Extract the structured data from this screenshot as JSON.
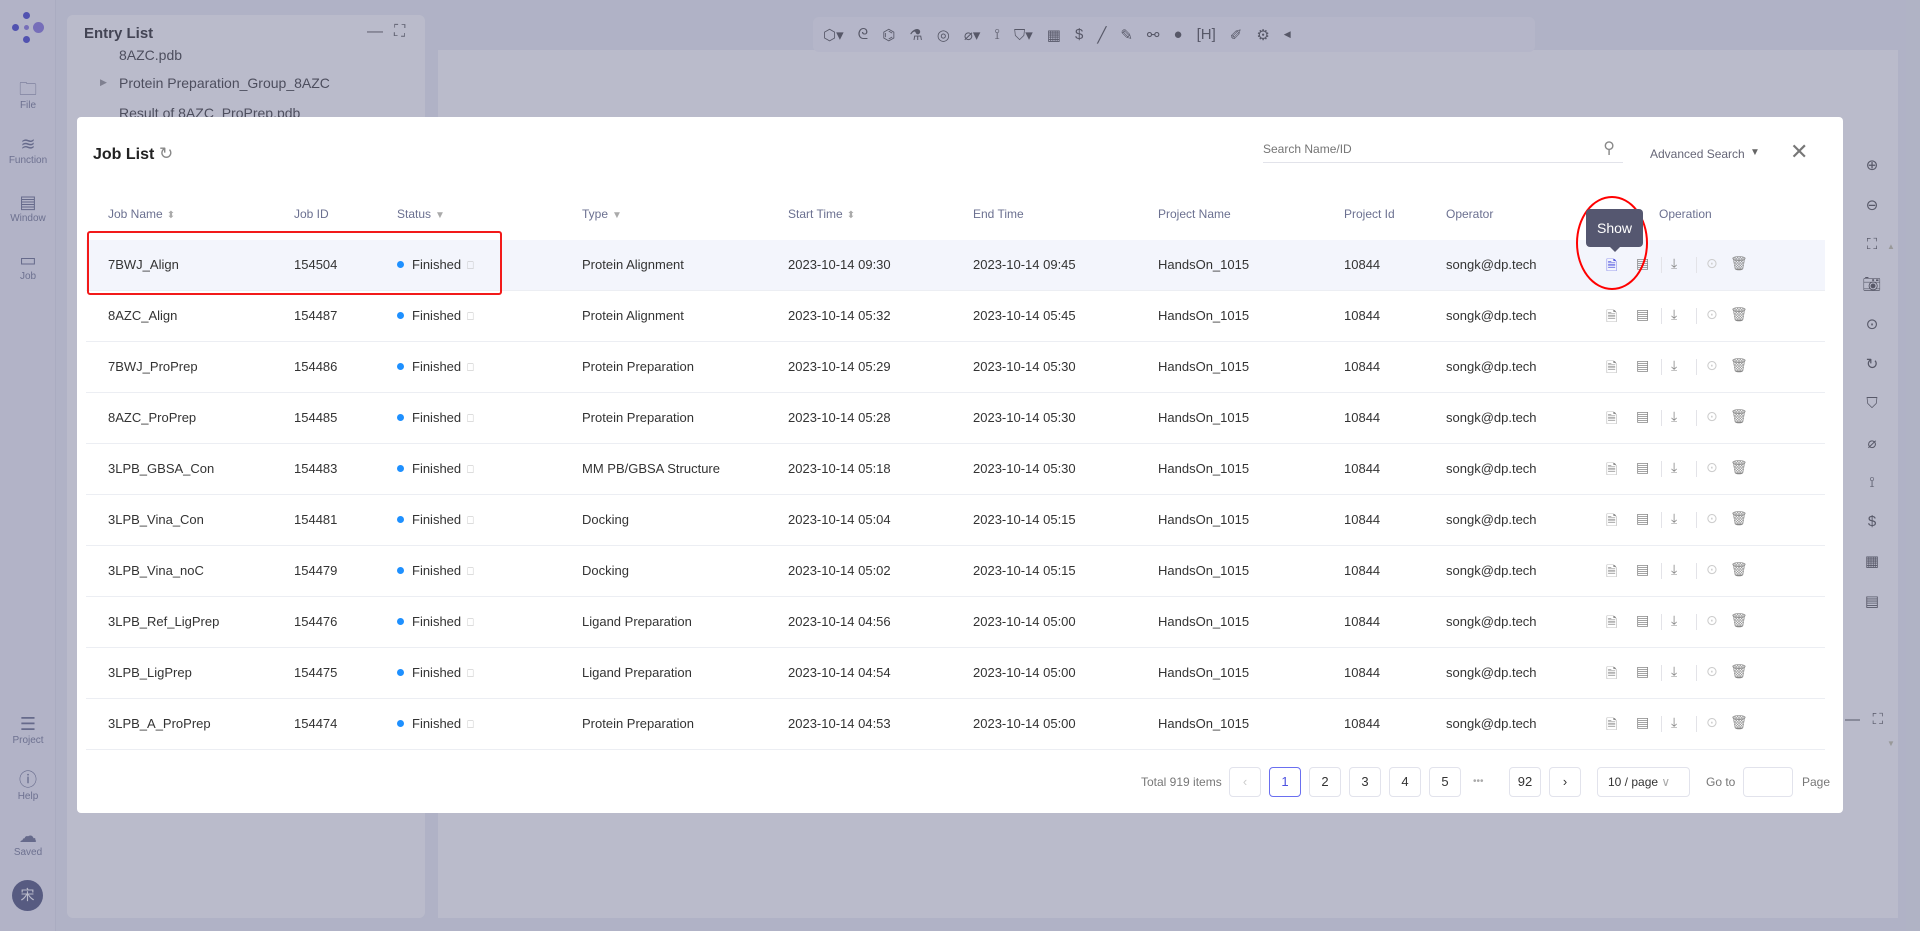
{
  "sidebar": {
    "items": [
      {
        "label": "File",
        "icon": "folder-plus-icon"
      },
      {
        "label": "Function",
        "icon": "layers-flask-icon"
      },
      {
        "label": "Window",
        "icon": "layout-icon"
      },
      {
        "label": "Job",
        "icon": "monitor-chart-icon"
      }
    ],
    "bottom": [
      {
        "label": "Project",
        "icon": "list-icon"
      },
      {
        "label": "Help",
        "icon": "question-icon"
      },
      {
        "label": "Saved",
        "icon": "cloud-icon"
      }
    ],
    "avatar": "宋"
  },
  "entry_list": {
    "title": "Entry List",
    "items": [
      "8AZC.pdb",
      "Protein Preparation_Group_8AZC",
      "Result of 8AZC_ProPrep.pdb"
    ]
  },
  "modal": {
    "title": "Job List",
    "search_placeholder": "Search Name/ID",
    "advanced_search": "Advanced Search",
    "columns": [
      "Job Name",
      "Job ID",
      "Status",
      "Type",
      "Start Time",
      "End Time",
      "Project Name",
      "Project Id",
      "Operator",
      "Operation"
    ],
    "rows": [
      [
        "7BWJ_Align",
        "154504",
        "Finished",
        "Protein Alignment",
        "2023-10-14 09:30",
        "2023-10-14 09:45",
        "HandsOn_1015",
        "10844",
        "songk@dp.tech"
      ],
      [
        "8AZC_Align",
        "154487",
        "Finished",
        "Protein Alignment",
        "2023-10-14 05:32",
        "2023-10-14 05:45",
        "HandsOn_1015",
        "10844",
        "songk@dp.tech"
      ],
      [
        "7BWJ_ProPrep",
        "154486",
        "Finished",
        "Protein Preparation",
        "2023-10-14 05:29",
        "2023-10-14 05:30",
        "HandsOn_1015",
        "10844",
        "songk@dp.tech"
      ],
      [
        "8AZC_ProPrep",
        "154485",
        "Finished",
        "Protein Preparation",
        "2023-10-14 05:28",
        "2023-10-14 05:30",
        "HandsOn_1015",
        "10844",
        "songk@dp.tech"
      ],
      [
        "3LPB_GBSA_Con",
        "154483",
        "Finished",
        "MM PB/GBSA Structure",
        "2023-10-14 05:18",
        "2023-10-14 05:30",
        "HandsOn_1015",
        "10844",
        "songk@dp.tech"
      ],
      [
        "3LPB_Vina_Con",
        "154481",
        "Finished",
        "Docking",
        "2023-10-14 05:04",
        "2023-10-14 05:15",
        "HandsOn_1015",
        "10844",
        "songk@dp.tech"
      ],
      [
        "3LPB_Vina_noC",
        "154479",
        "Finished",
        "Docking",
        "2023-10-14 05:02",
        "2023-10-14 05:15",
        "HandsOn_1015",
        "10844",
        "songk@dp.tech"
      ],
      [
        "3LPB_Ref_LigPrep",
        "154476",
        "Finished",
        "Ligand Preparation",
        "2023-10-14 04:56",
        "2023-10-14 05:00",
        "HandsOn_1015",
        "10844",
        "songk@dp.tech"
      ],
      [
        "3LPB_LigPrep",
        "154475",
        "Finished",
        "Ligand Preparation",
        "2023-10-14 04:54",
        "2023-10-14 05:00",
        "HandsOn_1015",
        "10844",
        "songk@dp.tech"
      ],
      [
        "3LPB_A_ProPrep",
        "154474",
        "Finished",
        "Protein Preparation",
        "2023-10-14 04:53",
        "2023-10-14 05:00",
        "HandsOn_1015",
        "10844",
        "songk@dp.tech"
      ]
    ],
    "tooltip": "Show",
    "pagination": {
      "total": "Total 919 items",
      "pages": [
        "1",
        "2",
        "3",
        "4",
        "5",
        "92"
      ],
      "ellipsis": "•••",
      "current": "1",
      "page_size": "10 / page",
      "goto": "Go to",
      "page": "Page",
      "goto_value": ""
    }
  },
  "colors": {
    "accent": "#4b50e0",
    "status_finished": "#1e90ff",
    "highlight": "#f21a1a"
  }
}
